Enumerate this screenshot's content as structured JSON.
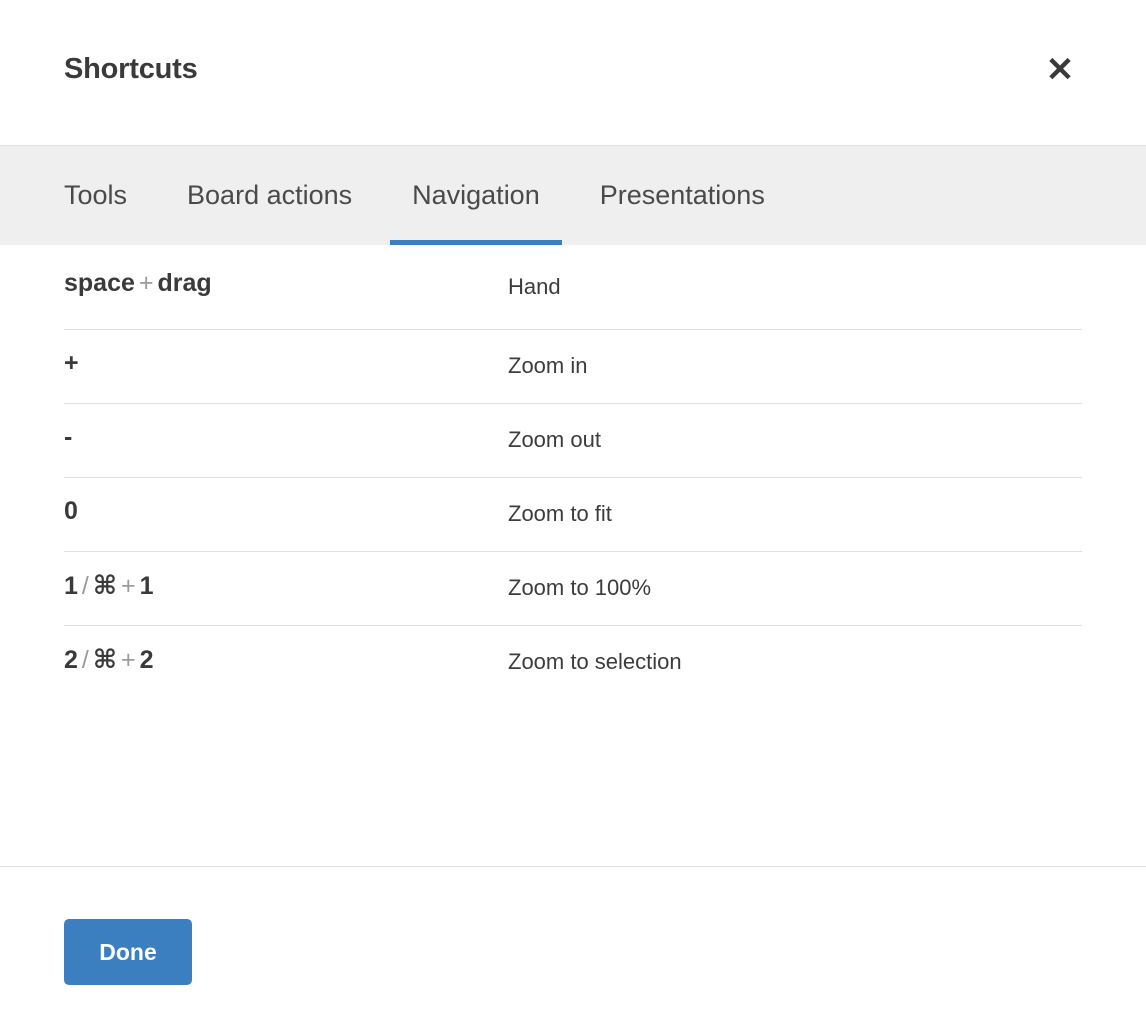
{
  "dialog": {
    "title": "Shortcuts",
    "close_icon": "close-icon",
    "close_glyph": "✕"
  },
  "tabs": [
    {
      "label": "Tools",
      "active": false
    },
    {
      "label": "Board actions",
      "active": false
    },
    {
      "label": "Navigation",
      "active": true
    },
    {
      "label": "Presentations",
      "active": false
    }
  ],
  "shortcuts": [
    {
      "keys": [
        {
          "text": "space",
          "type": "key"
        },
        {
          "text": "+",
          "type": "sep"
        },
        {
          "text": "drag",
          "type": "key"
        }
      ],
      "description": "Hand"
    },
    {
      "keys": [
        {
          "text": "+",
          "type": "key"
        }
      ],
      "description": "Zoom in"
    },
    {
      "keys": [
        {
          "text": "-",
          "type": "key"
        }
      ],
      "description": "Zoom out"
    },
    {
      "keys": [
        {
          "text": "0",
          "type": "key"
        }
      ],
      "description": "Zoom to fit"
    },
    {
      "keys": [
        {
          "text": "1",
          "type": "key"
        },
        {
          "text": "/",
          "type": "sep"
        },
        {
          "text": "⌘",
          "type": "cmd"
        },
        {
          "text": "+",
          "type": "sep"
        },
        {
          "text": "1",
          "type": "key"
        }
      ],
      "description": "Zoom to 100%"
    },
    {
      "keys": [
        {
          "text": "2",
          "type": "key"
        },
        {
          "text": "/",
          "type": "sep"
        },
        {
          "text": "⌘",
          "type": "cmd"
        },
        {
          "text": "+",
          "type": "sep"
        },
        {
          "text": "2",
          "type": "key"
        }
      ],
      "description": "Zoom to selection"
    }
  ],
  "footer": {
    "done_label": "Done"
  },
  "colors": {
    "accent": "#3c7fc0",
    "tab_bar_bg": "#efefef",
    "divider": "#e0e0e0",
    "text": "#3c3c3c",
    "text_muted": "#9b9b9b"
  }
}
